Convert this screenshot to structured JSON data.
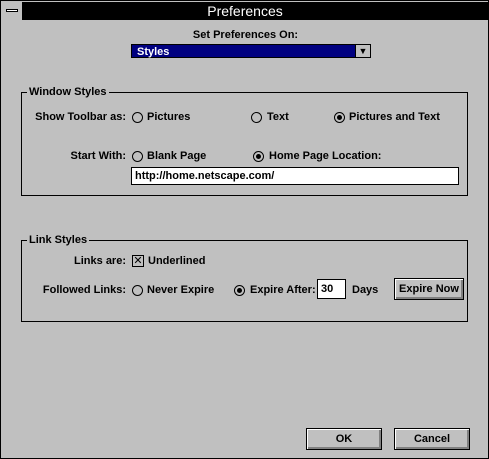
{
  "window": {
    "title": "Preferences"
  },
  "set_pref": {
    "label": "Set Preferences On:",
    "value": "Styles"
  },
  "window_styles": {
    "legend": "Window Styles",
    "toolbar_label": "Show Toolbar as:",
    "toolbar_options": [
      "Pictures",
      "Text",
      "Pictures and Text"
    ],
    "toolbar_selected": "Pictures and Text",
    "start_label": "Start With:",
    "start_options": [
      "Blank Page",
      "Home Page Location:"
    ],
    "start_selected": "Home Page Location:",
    "home_url": "http://home.netscape.com/"
  },
  "link_styles": {
    "legend": "Link Styles",
    "links_label": "Links are:",
    "underlined_label": "Underlined",
    "underlined_checked": true,
    "followed_label": "Followed Links:",
    "never_expire_label": "Never Expire",
    "expire_after_label": "Expire After:",
    "expire_selected": "Expire After:",
    "days_value": "30",
    "days_label": "Days",
    "expire_now_label": "Expire Now"
  },
  "buttons": {
    "ok": "OK",
    "cancel": "Cancel"
  },
  "icons": {
    "dropdown": "dropdown-arrow-icon",
    "sysmenu": "system-menu-icon",
    "checkmark": "x-mark-icon"
  }
}
